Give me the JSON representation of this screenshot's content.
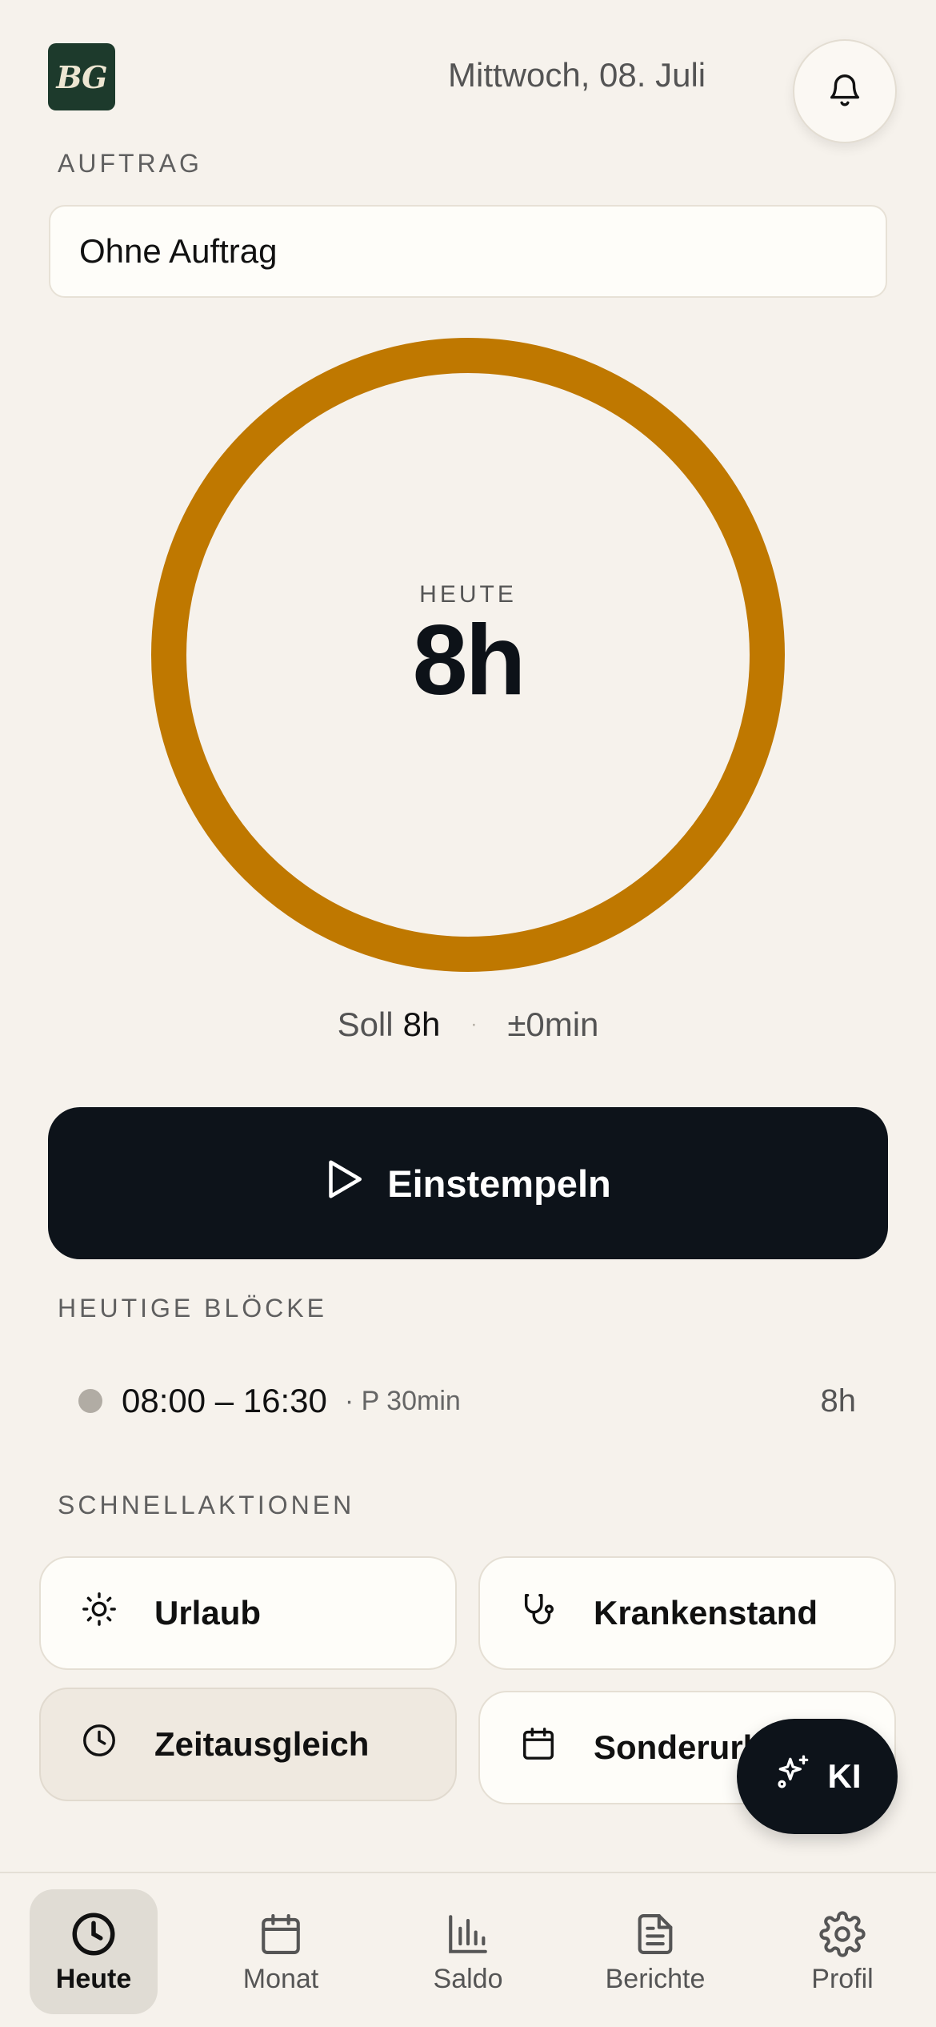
{
  "header": {
    "logo_text": "BG",
    "date": "Mittwoch, 08. Juli",
    "bell_icon": "bell-icon"
  },
  "order": {
    "label": "AUFTRAG",
    "value": "Ohne Auftrag"
  },
  "today": {
    "label": "HEUTE",
    "value": "8h",
    "progress": 1.0,
    "ring_color": "#bf7800",
    "target_label": "Soll",
    "target_value": "8h",
    "separator": "·",
    "balance": "±0min"
  },
  "clock_in": {
    "label": "Einstempeln",
    "icon": "play-icon"
  },
  "blocks": {
    "label": "HEUTIGE BLÖCKE",
    "items": [
      {
        "time": "08:00 – 16:30",
        "pause": "· P 30min",
        "hours": "8h"
      }
    ]
  },
  "quick_actions": {
    "label": "SCHNELLAKTIONEN",
    "items": [
      {
        "label": "Urlaub",
        "icon": "sun-icon"
      },
      {
        "label": "Krankenstand",
        "icon": "stethoscope-icon"
      },
      {
        "label": "Zeitausgleich",
        "icon": "clock-icon"
      },
      {
        "label": "Sonderurlaub",
        "icon": "calendar-icon"
      }
    ]
  },
  "ki_button": {
    "label": "KI",
    "icon": "sparkles-icon"
  },
  "tabs": [
    {
      "label": "Heute",
      "icon": "clock-icon",
      "active": true
    },
    {
      "label": "Monat",
      "icon": "calendar-icon",
      "active": false
    },
    {
      "label": "Saldo",
      "icon": "bar-chart-icon",
      "active": false
    },
    {
      "label": "Berichte",
      "icon": "document-icon",
      "active": false
    },
    {
      "label": "Profil",
      "icon": "gear-icon",
      "active": false
    }
  ],
  "colors": {
    "background": "#f6f2ec",
    "accent": "#bf7800",
    "dark": "#0d131a",
    "logo_bg": "#1d3a2c"
  }
}
